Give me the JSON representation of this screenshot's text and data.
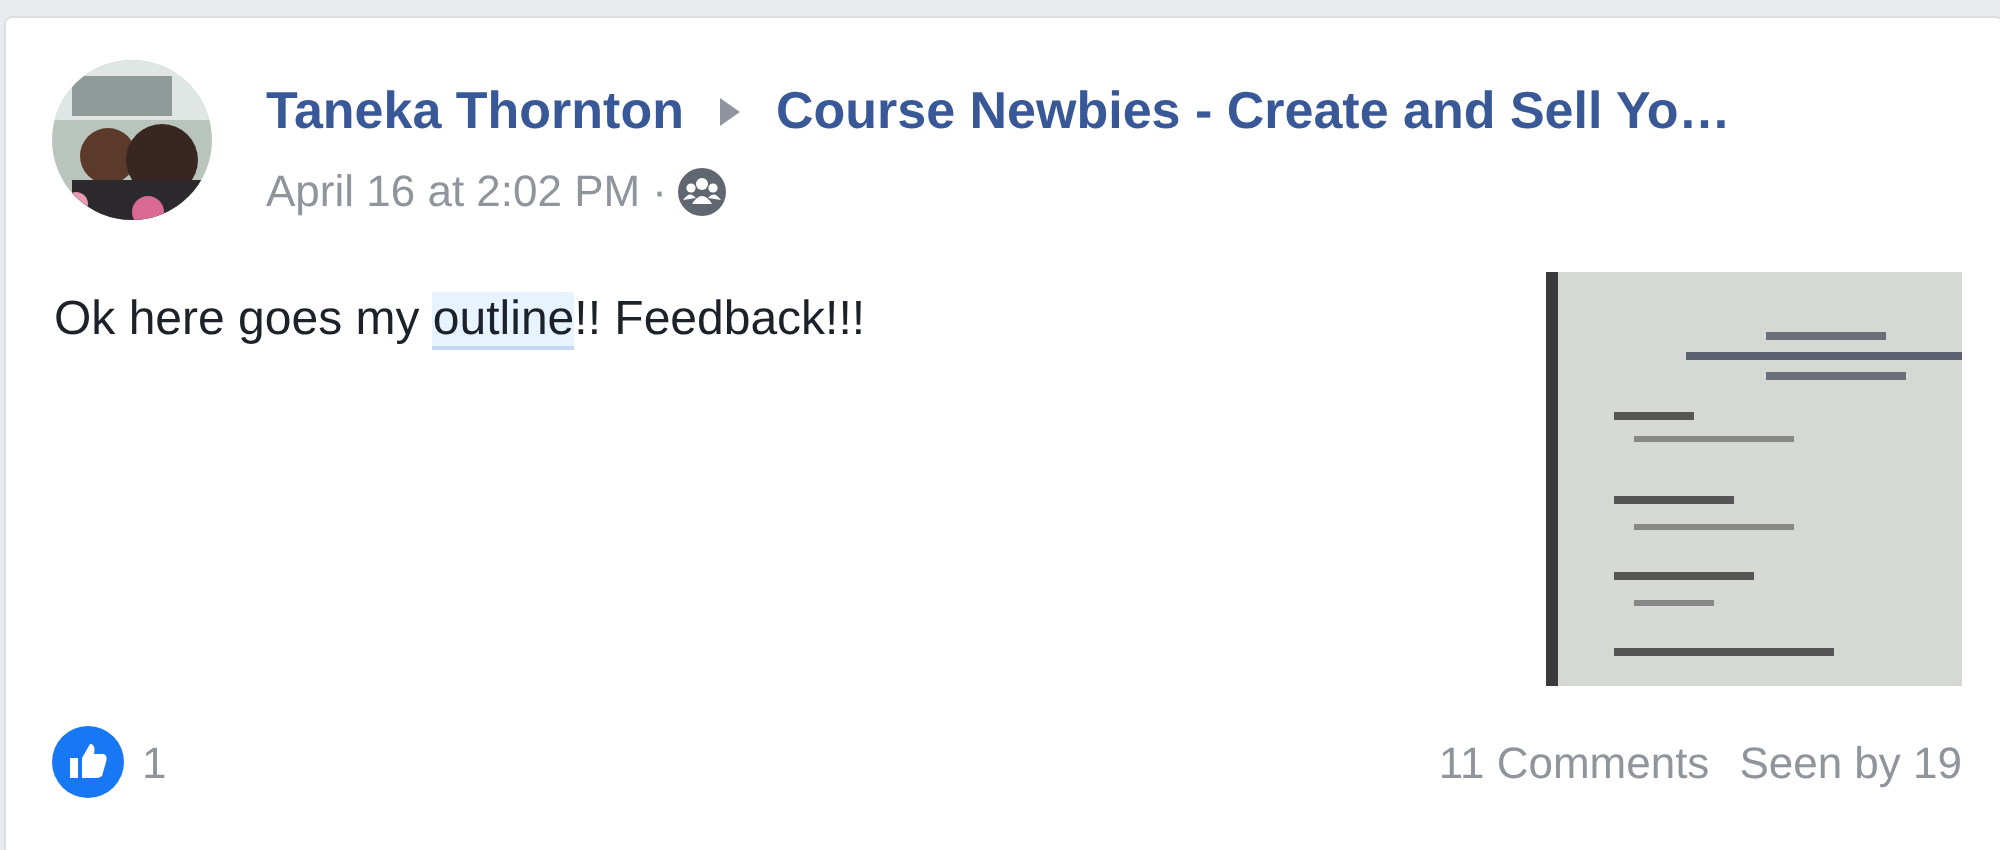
{
  "post": {
    "author": "Taneka Thornton",
    "group": "Course Newbies - Create and Sell Yo…",
    "timestamp": "April 16 at 2:02 PM",
    "separator": "·",
    "text": [
      {
        "kind": "plain",
        "text": "Ok here goes my "
      },
      {
        "kind": "highlight",
        "text": "outline"
      },
      {
        "kind": "plain",
        "text": "!! Feedback!!!"
      }
    ]
  },
  "footer": {
    "reactions": "1",
    "comments": "11 Comments",
    "seen": "Seen by 19"
  }
}
